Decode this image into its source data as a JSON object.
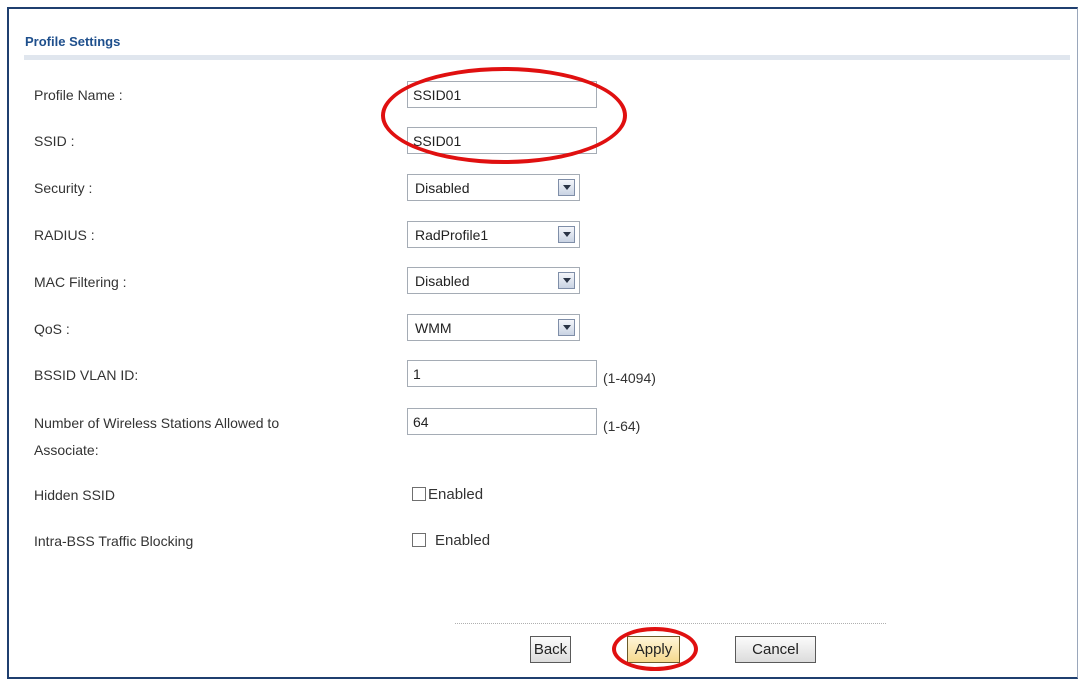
{
  "section": {
    "title": "Profile Settings"
  },
  "fields": {
    "profile_name": {
      "label": "Profile Name :",
      "value": "SSID01"
    },
    "ssid": {
      "label": "SSID :",
      "value": "SSID01"
    },
    "security": {
      "label": "Security :",
      "value": "Disabled"
    },
    "radius": {
      "label": "RADIUS :",
      "value": "RadProfile1"
    },
    "mac_filtering": {
      "label": "MAC Filtering :",
      "value": "Disabled"
    },
    "qos": {
      "label": "QoS :",
      "value": "WMM"
    },
    "bssid_vlan": {
      "label": "BSSID VLAN ID:",
      "value": "1",
      "range": "(1-4094)"
    },
    "stations": {
      "label_line1": "Number of Wireless Stations Allowed to",
      "label_line2": "Associate:",
      "value": "64",
      "range": "(1-64)"
    },
    "hidden_ssid": {
      "label": "Hidden SSID",
      "checkbox_label": "Enabled",
      "checked": false
    },
    "intra_bss": {
      "label": "Intra-BSS Traffic Blocking",
      "checkbox_label": "Enabled",
      "checked": false
    }
  },
  "buttons": {
    "back": "Back",
    "apply": "Apply",
    "cancel": "Cancel"
  },
  "colors": {
    "title": "#1e4f8c",
    "highlight": "#e01010",
    "frame": "#1f3f6f"
  },
  "icons": {
    "dropdown": "chevron-down-icon",
    "checkbox": "checkbox-icon"
  }
}
